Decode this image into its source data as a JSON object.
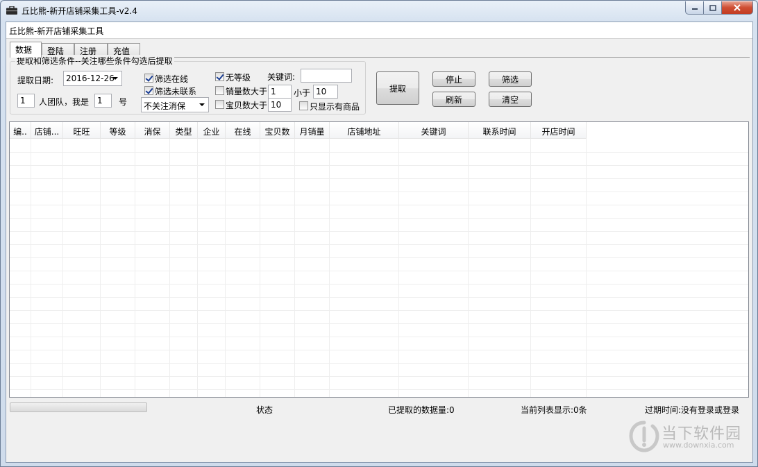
{
  "window": {
    "title": "丘比熊-新开店铺采集工具-v2.4",
    "caption": "丘比熊-新开店铺采集工具"
  },
  "tabs": [
    {
      "label": "数据",
      "active": true
    },
    {
      "label": "登陆",
      "active": false
    },
    {
      "label": "注册",
      "active": false
    },
    {
      "label": "充值",
      "active": false
    }
  ],
  "filters": {
    "group_title": "提取和筛选条件--关注哪些条件勾选后提取",
    "date_label": "提取日期:",
    "date_value": "2016-12-26",
    "team_count": "1",
    "team_label": "人团队，我是",
    "my_number": "1",
    "number_suffix": "号",
    "online": {
      "label": "筛选在线",
      "checked": true
    },
    "uncontacted": {
      "label": "筛选未联系",
      "checked": true
    },
    "consumer_protection": "不关注消保",
    "no_level": {
      "label": "无等级",
      "checked": true
    },
    "sales_gt": {
      "label": "销量数大于",
      "checked": false,
      "value": "1"
    },
    "sales_lt": {
      "label": "小于",
      "value": "10"
    },
    "items_gt": {
      "label": "宝贝数大于",
      "checked": false,
      "value": "10"
    },
    "only_with_goods": {
      "label": "只显示有商品",
      "checked": false
    },
    "keyword_label": "关键词:",
    "keyword_value": ""
  },
  "buttons": {
    "extract": "提取",
    "stop": "停止",
    "filter": "筛选",
    "refresh": "刷新",
    "clear": "清空"
  },
  "table": {
    "columns": [
      "编..",
      "店铺...",
      "旺旺",
      "等级",
      "消保",
      "类型",
      "企业",
      "在线",
      "宝贝数",
      "月销量",
      "店铺地址",
      "关键词",
      "联系时间",
      "开店时间"
    ],
    "rows": []
  },
  "status": {
    "state": "状态",
    "extracted": "已提取的数据量:0",
    "displayed": "当前列表显示:0条",
    "expiry": "过期时间:没有登录或登录"
  },
  "watermark": {
    "text": "当下软件园",
    "url": "www.downxia.com"
  }
}
